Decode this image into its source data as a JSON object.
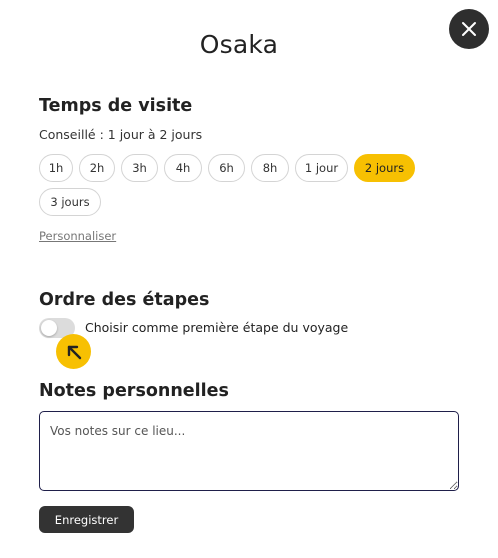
{
  "modal": {
    "title": "Osaka",
    "close_icon": "close-icon"
  },
  "visit_time": {
    "heading": "Temps de visite",
    "recommended": "Conseillé : 1 jour à 2 jours",
    "options": [
      "1h",
      "2h",
      "3h",
      "4h",
      "6h",
      "8h",
      "1 jour",
      "2 jours",
      "3 jours"
    ],
    "selected": "2 jours",
    "custom_link": "Personnaliser"
  },
  "step_order": {
    "heading": "Ordre des étapes",
    "toggle_label": "Choisir comme première étape du voyage",
    "toggle_on": false,
    "hint_icon": "arrow-up-left-icon"
  },
  "notes": {
    "heading": "Notes personnelles",
    "placeholder": "Vos notes sur ce lieu...",
    "value": ""
  },
  "actions": {
    "save_label": "Enregistrer"
  },
  "colors": {
    "accent": "#f7c002",
    "dark": "#2e2e2e",
    "chip_border": "#d4d4d4",
    "input_border": "#1f1f4a"
  }
}
